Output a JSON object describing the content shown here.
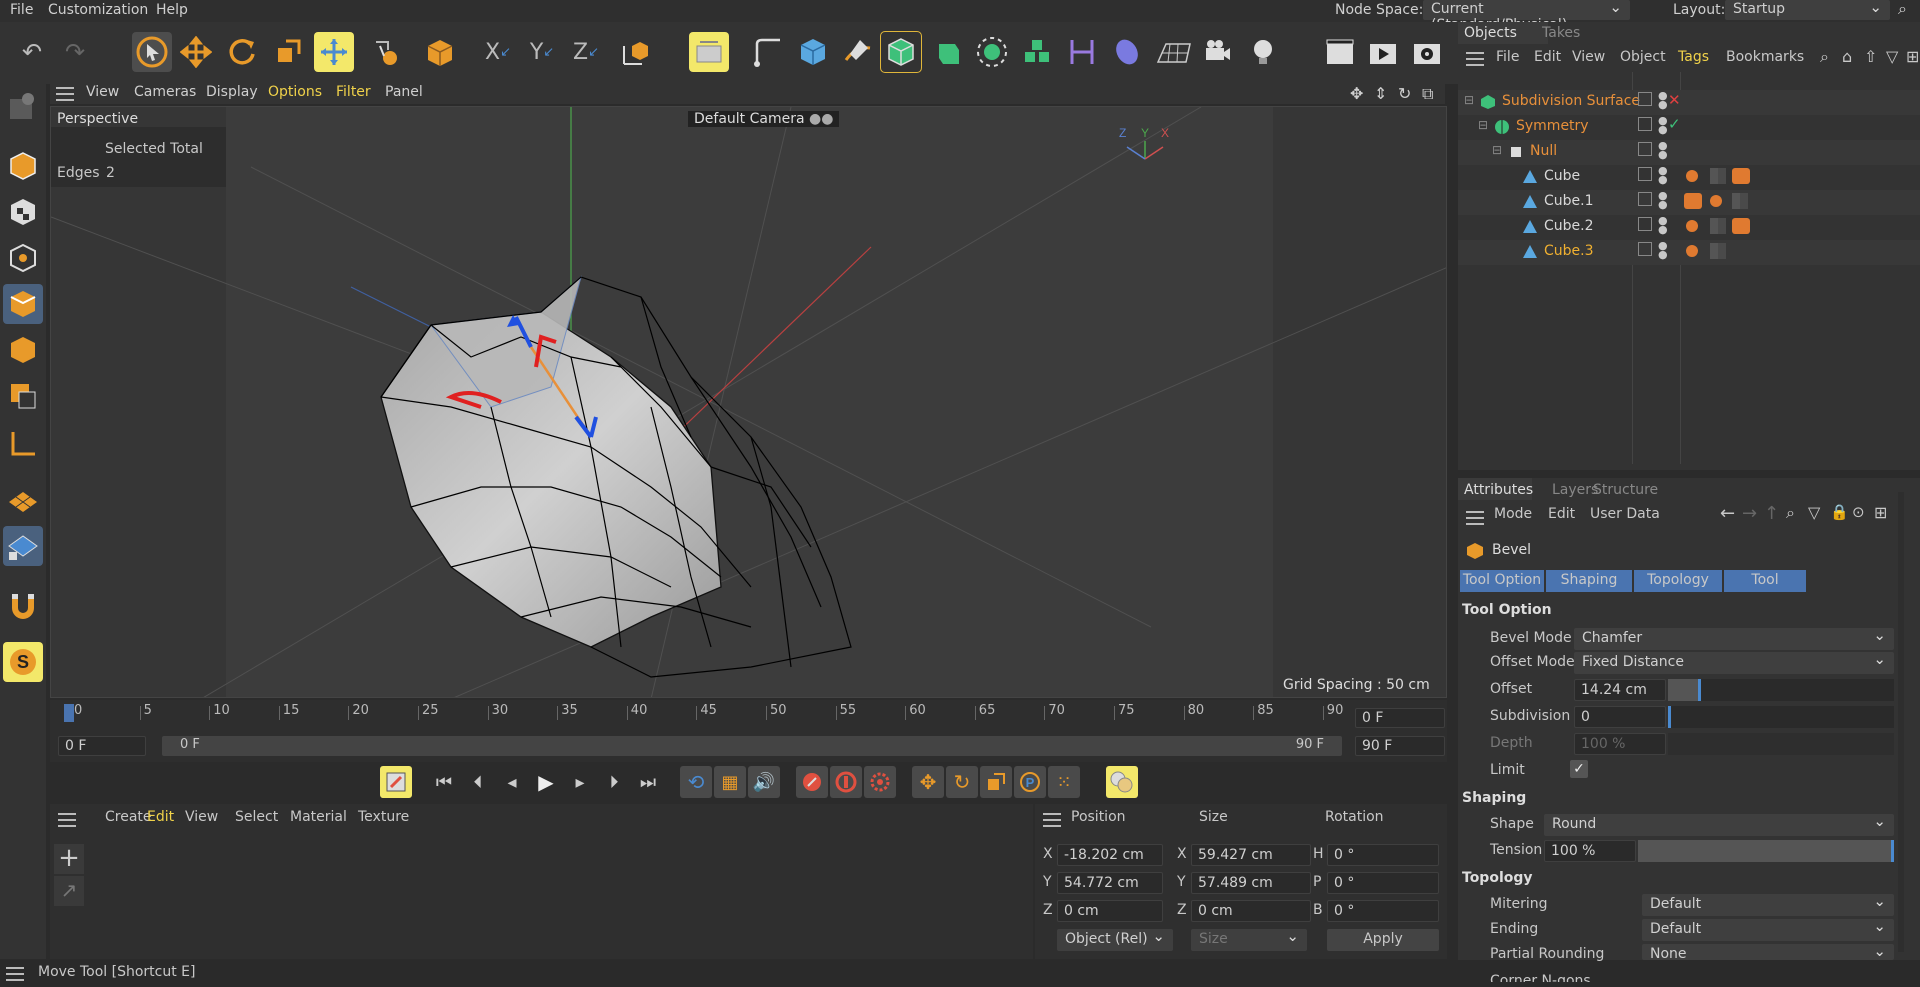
{
  "menubar": {
    "items": [
      "File",
      "Customization",
      "Help"
    ],
    "node_space_label": "Node Space:",
    "node_space_value": "Current (Standard/Physical)",
    "layout_label": "Layout:",
    "layout_value": "Startup"
  },
  "viewport_menu": {
    "items": [
      "View",
      "Cameras",
      "Display",
      "Options",
      "Filter",
      "Panel"
    ],
    "highlight_color": "#f0d24a"
  },
  "viewport": {
    "name": "Perspective",
    "camera": "Default Camera",
    "hud": {
      "selected_total_label": "Selected Total",
      "edges_label": "Edges",
      "edges_value": "2"
    },
    "grid_spacing": "Grid Spacing : 50 cm",
    "axis_labels": [
      "Z",
      "Y",
      "X"
    ]
  },
  "timeline": {
    "ticks": [
      "0",
      "5",
      "10",
      "15",
      "20",
      "25",
      "30",
      "35",
      "40",
      "45",
      "50",
      "55",
      "60",
      "65",
      "70",
      "75",
      "80",
      "85",
      "90"
    ],
    "current_frame": "0 F",
    "start_frame": "0 F",
    "range_start": "0 F",
    "range_end": "90 F",
    "end_frame": "90 F"
  },
  "material_manager": {
    "menu": [
      "Create",
      "Edit",
      "View",
      "Select",
      "Material",
      "Texture"
    ]
  },
  "coordinates": {
    "headers": [
      "Position",
      "Size",
      "Rotation"
    ],
    "rows": [
      {
        "axis": "X",
        "position": "-18.202 cm",
        "size_axis": "X",
        "size": "59.427 cm",
        "rot_axis": "H",
        "rotation": "0 °"
      },
      {
        "axis": "Y",
        "position": "54.772 cm",
        "size_axis": "Y",
        "size": "57.489 cm",
        "rot_axis": "P",
        "rotation": "0 °"
      },
      {
        "axis": "Z",
        "position": "0 cm",
        "size_axis": "Z",
        "size": "0 cm",
        "rot_axis": "B",
        "rotation": "0 °"
      }
    ],
    "mode_value": "Object (Rel)",
    "size_mode_value": "Size",
    "apply_label": "Apply"
  },
  "status": {
    "text": "Move Tool [Shortcut E]"
  },
  "objects_panel": {
    "tabs": [
      "Objects",
      "Takes"
    ],
    "menu": [
      "File",
      "Edit",
      "View",
      "Object",
      "Tags",
      "Bookmarks"
    ],
    "items": [
      {
        "name": "Subdivision Surface",
        "depth": 0,
        "color": "#e8903a"
      },
      {
        "name": "Symmetry",
        "depth": 1,
        "color": "#e8903a"
      },
      {
        "name": "Null",
        "depth": 2,
        "color": "#e8903a"
      },
      {
        "name": "Cube",
        "depth": 3,
        "color": "#d8d8d8"
      },
      {
        "name": "Cube.1",
        "depth": 3,
        "color": "#d8d8d8"
      },
      {
        "name": "Cube.2",
        "depth": 3,
        "color": "#d8d8d8"
      },
      {
        "name": "Cube.3",
        "depth": 3,
        "color": "#f0b030"
      }
    ]
  },
  "attributes_panel": {
    "tabs": [
      "Attributes",
      "Layers",
      "Structure"
    ],
    "menu": [
      "Mode",
      "Edit",
      "User Data"
    ],
    "tool_name": "Bevel",
    "subtabs": [
      "Tool Option",
      "Shaping",
      "Topology",
      "Tool"
    ],
    "tool_option": {
      "heading": "Tool Option",
      "bevel_mode_label": "Bevel Mode",
      "bevel_mode_value": "Chamfer",
      "offset_mode_label": "Offset Mode",
      "offset_mode_value": "Fixed Distance",
      "offset_label": "Offset",
      "offset_value": "14.24 cm",
      "subdivision_label": "Subdivision",
      "subdivision_value": "0",
      "depth_label": "Depth",
      "depth_value": "100 %",
      "limit_label": "Limit"
    },
    "shaping": {
      "heading": "Shaping",
      "shape_label": "Shape",
      "shape_value": "Round",
      "tension_label": "Tension",
      "tension_value": "100 %"
    },
    "topology": {
      "heading": "Topology",
      "mitering_label": "Mitering",
      "mitering_value": "Default",
      "ending_label": "Ending",
      "ending_value": "Default",
      "partial_rounding_label": "Partial Rounding",
      "partial_rounding_value": "None",
      "corner_label": "Corner N-gons"
    }
  },
  "colors": {
    "accent_blue": "#4a74b0",
    "accent_orange": "#e8903a",
    "highlight_yellow": "#f3e86a"
  }
}
